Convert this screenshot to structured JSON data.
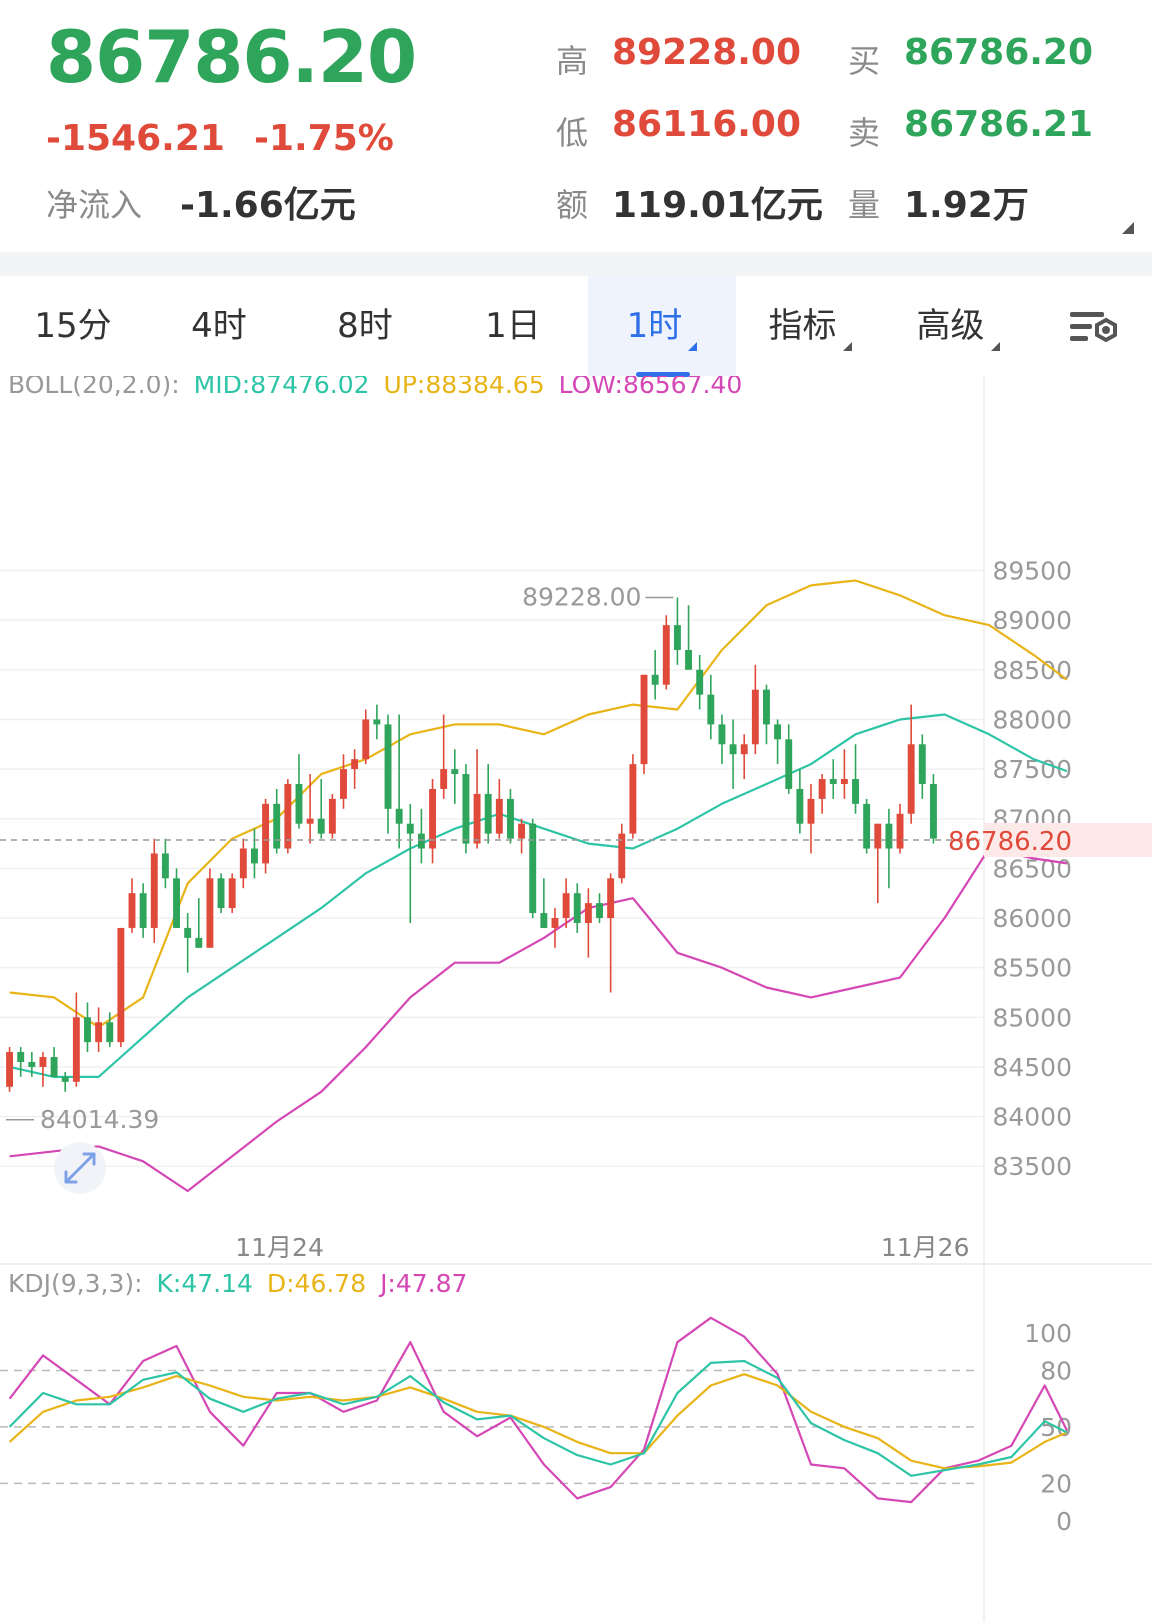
{
  "quote": {
    "price": "86786.20",
    "change": "-1546.21",
    "change_pct": "-1.75%",
    "net_inflow_label": "净流入",
    "net_inflow": "-1.66亿元",
    "high_label": "高",
    "high": "89228.00",
    "low_label": "低",
    "low": "86116.00",
    "amount_label": "额",
    "amount": "119.01亿元",
    "buy_label": "买",
    "buy": "86786.20",
    "sell_label": "卖",
    "sell": "86786.21",
    "volume_label": "量",
    "volume": "1.92万",
    "up_color": "#e04a3a",
    "down_color": "#2ea55a"
  },
  "tabs": [
    {
      "label": "15分",
      "active": false,
      "dropdown": false
    },
    {
      "label": "4时",
      "active": false,
      "dropdown": false
    },
    {
      "label": "8时",
      "active": false,
      "dropdown": false
    },
    {
      "label": "1日",
      "active": false,
      "dropdown": false
    },
    {
      "label": "1时",
      "active": true,
      "dropdown": true
    },
    {
      "label": "指标",
      "active": false,
      "dropdown": true
    },
    {
      "label": "高级",
      "active": false,
      "dropdown": true
    }
  ],
  "settings_icon": "chart-settings-icon",
  "chart_data": [
    {
      "type": "candlestick",
      "indicator_label": "BOLL(20,2.0):",
      "mid_label": "MID:87476.02",
      "up_label": "UP:88384.65",
      "low_label": "LOW:86567.40",
      "ylim": [
        83200,
        90150
      ],
      "y_ticks": [
        89500,
        89000,
        88500,
        88000,
        87500,
        87000,
        86500,
        86000,
        85500,
        85000,
        84500,
        84000,
        83500
      ],
      "x_labels": [
        "11月24",
        "11月26"
      ],
      "high_marker": "89228.00",
      "low_marker": "84014.39",
      "last_price": "86786.20",
      "last_price_value": 86786.2,
      "colors": {
        "mid": "#2ec4a6",
        "up": "#e8b418",
        "low": "#d447b5",
        "rise": "#e04a3a",
        "fall": "#2ea55a"
      },
      "candles": [
        [
          84300,
          84700,
          84250,
          84650
        ],
        [
          84650,
          84700,
          84400,
          84550
        ],
        [
          84550,
          84650,
          84400,
          84500
        ],
        [
          84500,
          84650,
          84300,
          84600
        ],
        [
          84600,
          84700,
          84450,
          84400
        ],
        [
          84400,
          84450,
          84250,
          84350
        ],
        [
          84350,
          85250,
          84300,
          85000
        ],
        [
          85000,
          85150,
          84650,
          84750
        ],
        [
          84750,
          85100,
          84650,
          84950
        ],
        [
          84950,
          85050,
          84700,
          84750
        ],
        [
          84750,
          85900,
          84700,
          85900
        ],
        [
          85900,
          86400,
          85850,
          86250
        ],
        [
          86250,
          86350,
          85800,
          85900
        ],
        [
          85900,
          86800,
          85750,
          86650
        ],
        [
          86650,
          86800,
          86300,
          86400
        ],
        [
          86400,
          86500,
          85900,
          85900
        ],
        [
          85900,
          86050,
          85450,
          85800
        ],
        [
          85800,
          86200,
          85700,
          85700
        ],
        [
          85700,
          86500,
          85700,
          86400
        ],
        [
          86400,
          86450,
          86050,
          86100
        ],
        [
          86100,
          86450,
          86050,
          86400
        ],
        [
          86400,
          86800,
          86300,
          86700
        ],
        [
          86700,
          86900,
          86400,
          86550
        ],
        [
          86550,
          87200,
          86450,
          87150
        ],
        [
          87150,
          87300,
          86650,
          86700
        ],
        [
          86700,
          87400,
          86650,
          87350
        ],
        [
          87350,
          87650,
          86900,
          86950
        ],
        [
          86950,
          87450,
          86750,
          87000
        ],
        [
          87000,
          87400,
          86800,
          86850
        ],
        [
          86850,
          87250,
          86800,
          87200
        ],
        [
          87200,
          87650,
          87100,
          87500
        ],
        [
          87500,
          87700,
          87300,
          87600
        ],
        [
          87600,
          88100,
          87550,
          88000
        ],
        [
          88000,
          88150,
          87800,
          87950
        ],
        [
          87950,
          88050,
          86850,
          87100
        ],
        [
          87100,
          88050,
          86700,
          86950
        ],
        [
          86950,
          87150,
          85950,
          86850
        ],
        [
          86850,
          87100,
          86550,
          86700
        ],
        [
          86700,
          87400,
          86550,
          87300
        ],
        [
          87300,
          88050,
          87200,
          87500
        ],
        [
          87500,
          87700,
          87150,
          87450
        ],
        [
          87450,
          87550,
          86650,
          86750
        ],
        [
          86750,
          87700,
          86700,
          87250
        ],
        [
          87250,
          87550,
          86750,
          86850
        ],
        [
          86850,
          87400,
          86800,
          87200
        ],
        [
          87200,
          87300,
          86750,
          86800
        ],
        [
          86800,
          87000,
          86650,
          86950
        ],
        [
          86950,
          87000,
          86000,
          86050
        ],
        [
          86050,
          86400,
          85900,
          85900
        ],
        [
          85900,
          86100,
          85700,
          86000
        ],
        [
          86000,
          86400,
          85900,
          86250
        ],
        [
          86250,
          86350,
          85850,
          85950
        ],
        [
          85950,
          86300,
          85600,
          86150
        ],
        [
          86150,
          86250,
          85950,
          86000
        ],
        [
          86000,
          86450,
          85250,
          86400
        ],
        [
          86400,
          86950,
          86350,
          86850
        ],
        [
          86850,
          87650,
          86800,
          87550
        ],
        [
          87550,
          88450,
          87450,
          88450
        ],
        [
          88450,
          88700,
          88200,
          88350
        ],
        [
          88350,
          89050,
          88300,
          88950
        ],
        [
          88950,
          89228,
          88550,
          88700
        ],
        [
          88700,
          89150,
          88700,
          88500
        ],
        [
          88500,
          88650,
          88100,
          88250
        ],
        [
          88250,
          88450,
          87800,
          87950
        ],
        [
          87950,
          88050,
          87550,
          87750
        ],
        [
          87750,
          88000,
          87300,
          87650
        ],
        [
          87650,
          87850,
          87400,
          87750
        ],
        [
          87750,
          88550,
          87650,
          88300
        ],
        [
          88300,
          88350,
          87750,
          87950
        ],
        [
          87950,
          88000,
          87550,
          87800
        ],
        [
          87800,
          87950,
          87250,
          87300
        ],
        [
          87300,
          87500,
          86850,
          86950
        ],
        [
          86950,
          87350,
          86650,
          87200
        ],
        [
          87200,
          87450,
          87050,
          87400
        ],
        [
          87400,
          87600,
          87200,
          87350
        ],
        [
          87350,
          87700,
          87200,
          87400
        ],
        [
          87400,
          87750,
          87050,
          87150
        ],
        [
          87150,
          87200,
          86650,
          86700
        ],
        [
          86700,
          86900,
          86150,
          86950
        ],
        [
          86950,
          87100,
          86300,
          86700
        ],
        [
          86700,
          87150,
          86650,
          87050
        ],
        [
          87050,
          88150,
          86950,
          87750
        ],
        [
          87750,
          87850,
          87200,
          87350
        ],
        [
          87350,
          87450,
          86750,
          86800
        ]
      ],
      "mid": [
        [
          0,
          84500
        ],
        [
          4,
          84400
        ],
        [
          8,
          84400
        ],
        [
          12,
          84800
        ],
        [
          16,
          85200
        ],
        [
          20,
          85500
        ],
        [
          24,
          85800
        ],
        [
          28,
          86100
        ],
        [
          32,
          86450
        ],
        [
          36,
          86700
        ],
        [
          40,
          86900
        ],
        [
          44,
          87050
        ],
        [
          48,
          86900
        ],
        [
          52,
          86750
        ],
        [
          56,
          86700
        ],
        [
          60,
          86900
        ],
        [
          64,
          87150
        ],
        [
          68,
          87350
        ],
        [
          72,
          87550
        ],
        [
          76,
          87850
        ],
        [
          80,
          88000
        ],
        [
          84,
          88050
        ],
        [
          88,
          87850
        ],
        [
          92,
          87600
        ],
        [
          95,
          87480
        ]
      ],
      "up": [
        [
          0,
          85250
        ],
        [
          4,
          85200
        ],
        [
          8,
          84900
        ],
        [
          12,
          85200
        ],
        [
          16,
          86350
        ],
        [
          20,
          86800
        ],
        [
          24,
          87000
        ],
        [
          28,
          87450
        ],
        [
          32,
          87600
        ],
        [
          36,
          87850
        ],
        [
          40,
          87950
        ],
        [
          44,
          87950
        ],
        [
          48,
          87850
        ],
        [
          52,
          88050
        ],
        [
          56,
          88150
        ],
        [
          60,
          88100
        ],
        [
          64,
          88700
        ],
        [
          68,
          89150
        ],
        [
          72,
          89350
        ],
        [
          76,
          89400
        ],
        [
          80,
          89250
        ],
        [
          84,
          89050
        ],
        [
          88,
          88950
        ],
        [
          92,
          88650
        ],
        [
          95,
          88400
        ]
      ],
      "low": [
        [
          0,
          83600
        ],
        [
          4,
          83650
        ],
        [
          8,
          83700
        ],
        [
          12,
          83550
        ],
        [
          16,
          83250
        ],
        [
          20,
          83600
        ],
        [
          24,
          83950
        ],
        [
          28,
          84250
        ],
        [
          32,
          84700
        ],
        [
          36,
          85200
        ],
        [
          40,
          85550
        ],
        [
          44,
          85550
        ],
        [
          48,
          85800
        ],
        [
          52,
          86100
        ],
        [
          56,
          86200
        ],
        [
          60,
          85650
        ],
        [
          64,
          85500
        ],
        [
          68,
          85300
        ],
        [
          72,
          85200
        ],
        [
          76,
          85300
        ],
        [
          80,
          85400
        ],
        [
          84,
          86000
        ],
        [
          88,
          86700
        ],
        [
          92,
          86600
        ],
        [
          95,
          86550
        ]
      ]
    },
    {
      "type": "line",
      "indicator_label": "KDJ(9,3,3):",
      "k_label": "K:47.14",
      "d_label": "D:46.78",
      "j_label": "J:47.87",
      "ylim": [
        -8,
        110
      ],
      "y_ticks": [
        100,
        80,
        50,
        20,
        0
      ],
      "gridlines": [
        80,
        50,
        20
      ],
      "colors": {
        "k": "#2ec4a6",
        "d": "#e8b418",
        "j": "#d447b5"
      },
      "k": [
        [
          0,
          50
        ],
        [
          3,
          68
        ],
        [
          6,
          62
        ],
        [
          9,
          62
        ],
        [
          12,
          75
        ],
        [
          15,
          79
        ],
        [
          18,
          65
        ],
        [
          21,
          58
        ],
        [
          24,
          65
        ],
        [
          27,
          68
        ],
        [
          30,
          62
        ],
        [
          33,
          66
        ],
        [
          36,
          77
        ],
        [
          39,
          63
        ],
        [
          42,
          54
        ],
        [
          45,
          56
        ],
        [
          48,
          44
        ],
        [
          51,
          35
        ],
        [
          54,
          30
        ],
        [
          57,
          36
        ],
        [
          60,
          68
        ],
        [
          63,
          84
        ],
        [
          66,
          85
        ],
        [
          69,
          76
        ],
        [
          72,
          52
        ],
        [
          75,
          43
        ],
        [
          78,
          36
        ],
        [
          81,
          24
        ],
        [
          84,
          27
        ],
        [
          87,
          30
        ],
        [
          90,
          34
        ],
        [
          93,
          53
        ],
        [
          95,
          47
        ]
      ],
      "d": [
        [
          0,
          42
        ],
        [
          3,
          58
        ],
        [
          6,
          64
        ],
        [
          9,
          66
        ],
        [
          12,
          71
        ],
        [
          15,
          77
        ],
        [
          18,
          72
        ],
        [
          21,
          66
        ],
        [
          24,
          64
        ],
        [
          27,
          66
        ],
        [
          30,
          64
        ],
        [
          33,
          66
        ],
        [
          36,
          71
        ],
        [
          39,
          65
        ],
        [
          42,
          58
        ],
        [
          45,
          56
        ],
        [
          48,
          50
        ],
        [
          51,
          42
        ],
        [
          54,
          36
        ],
        [
          57,
          36
        ],
        [
          60,
          56
        ],
        [
          63,
          72
        ],
        [
          66,
          78
        ],
        [
          69,
          72
        ],
        [
          72,
          58
        ],
        [
          75,
          50
        ],
        [
          78,
          44
        ],
        [
          81,
          32
        ],
        [
          84,
          28
        ],
        [
          87,
          29
        ],
        [
          90,
          31
        ],
        [
          93,
          42
        ],
        [
          95,
          47
        ]
      ],
      "j": [
        [
          0,
          65
        ],
        [
          3,
          88
        ],
        [
          6,
          75
        ],
        [
          9,
          62
        ],
        [
          12,
          85
        ],
        [
          15,
          93
        ],
        [
          18,
          58
        ],
        [
          21,
          40
        ],
        [
          24,
          68
        ],
        [
          27,
          68
        ],
        [
          30,
          58
        ],
        [
          33,
          64
        ],
        [
          36,
          95
        ],
        [
          39,
          58
        ],
        [
          42,
          45
        ],
        [
          45,
          55
        ],
        [
          48,
          30
        ],
        [
          51,
          12
        ],
        [
          54,
          18
        ],
        [
          57,
          38
        ],
        [
          60,
          95
        ],
        [
          63,
          108
        ],
        [
          66,
          98
        ],
        [
          69,
          78
        ],
        [
          72,
          30
        ],
        [
          75,
          28
        ],
        [
          78,
          12
        ],
        [
          81,
          10
        ],
        [
          84,
          28
        ],
        [
          87,
          32
        ],
        [
          90,
          40
        ],
        [
          93,
          72
        ],
        [
          95,
          48
        ]
      ]
    }
  ]
}
